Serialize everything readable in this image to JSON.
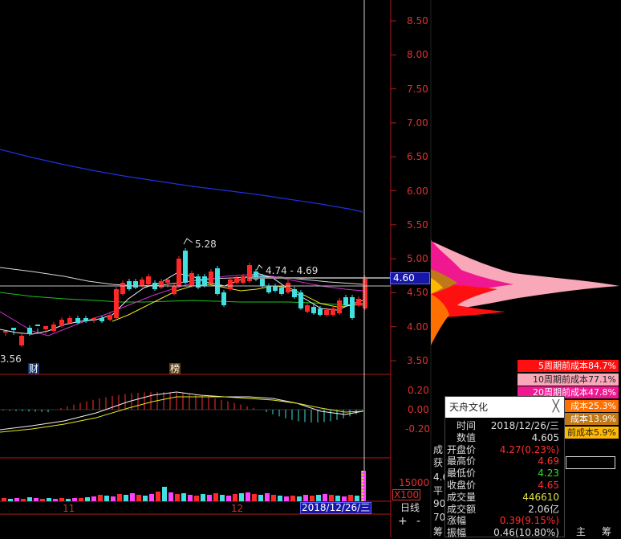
{
  "price_axis": {
    "ticks": [
      "8.50",
      "8.00",
      "7.50",
      "7.00",
      "6.50",
      "6.00",
      "5.50",
      "5.00",
      "4.50",
      "4.00",
      "3.50"
    ]
  },
  "current_price": "4.60",
  "annotations": {
    "high": "5.28",
    "range": "4.74 - 4.69",
    "low": "3.56"
  },
  "event_markers": {
    "cai": "财",
    "bang": "榜"
  },
  "macd_axis": {
    "ticks": [
      "0.20",
      "0.00",
      "-0.20"
    ]
  },
  "volume_axis": {
    "tick": "15000",
    "unit": "X100"
  },
  "date_axis": {
    "m11": "11",
    "m12": "12",
    "cursor_date": "2018/12/26/三",
    "period": "日线"
  },
  "buttons": {
    "plus": "+",
    "minus": "-"
  },
  "cost_legend": [
    {
      "label": "5周期前成本84.7%",
      "color": "#ff1010"
    },
    {
      "label": "10周期前成本77.1%",
      "color": "#f8a8b8"
    },
    {
      "label": "20周期前成本47.8%",
      "color": "#f01890"
    },
    {
      "label": "成本25.3%",
      "color": "#ff7000"
    },
    {
      "label": "成本13.9%",
      "color": "#c07818"
    },
    {
      "label": "前成本5.9%",
      "color": "#ffb800"
    }
  ],
  "tooltip": {
    "title": "天舟文化",
    "close": "╳",
    "rows": [
      {
        "k": "时间",
        "v": "2018/12/26/三",
        "color": "#dddddd"
      },
      {
        "k": "数值",
        "v": "4.605",
        "color": "#dddddd"
      },
      {
        "k": "开盘价",
        "v": "4.27(0.23%)",
        "color": "#ff3030"
      },
      {
        "k": "最高价",
        "v": "4.69",
        "color": "#ff3030"
      },
      {
        "k": "最低价",
        "v": "4.23",
        "color": "#30e030"
      },
      {
        "k": "收盘价",
        "v": "4.65",
        "color": "#ff3030"
      },
      {
        "k": "成交量",
        "v": "446610",
        "color": "#e0e040"
      },
      {
        "k": "成交额",
        "v": "2.06亿",
        "color": "#dddddd"
      },
      {
        "k": "涨幅",
        "v": "0.39(9.15%)",
        "color": "#ff3030"
      },
      {
        "k": "振幅",
        "v": "0.46(10.80%)",
        "color": "#dddddd"
      }
    ]
  },
  "side_labels": {
    "l1": "成",
    "l2": "获",
    "l3": "4.6",
    "l4": "平",
    "l5": "90",
    "l6": "70",
    "l7": "筹",
    "tab_zhu": "主",
    "tab_chou": "筹"
  }
}
